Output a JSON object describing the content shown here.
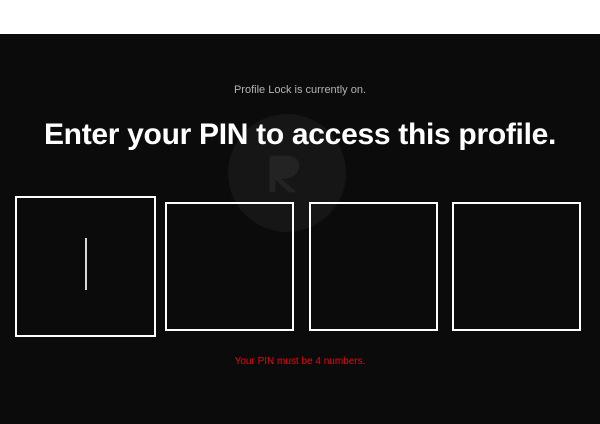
{
  "profile_lock": {
    "status_text": "Profile Lock is currently on.",
    "title": "Enter your PIN to access this profile.",
    "pin": {
      "digits": [
        "",
        "",
        "",
        ""
      ],
      "focused_index": 0
    },
    "error_text": "Your PIN must be 4 numbers."
  },
  "colors": {
    "background": "#0b0b0b",
    "text": "#ffffff",
    "muted_text": "#b3b3b3",
    "error": "#e50914",
    "box_border": "#ffffff"
  },
  "icons": {
    "watermark": "site-logo-watermark-icon"
  }
}
